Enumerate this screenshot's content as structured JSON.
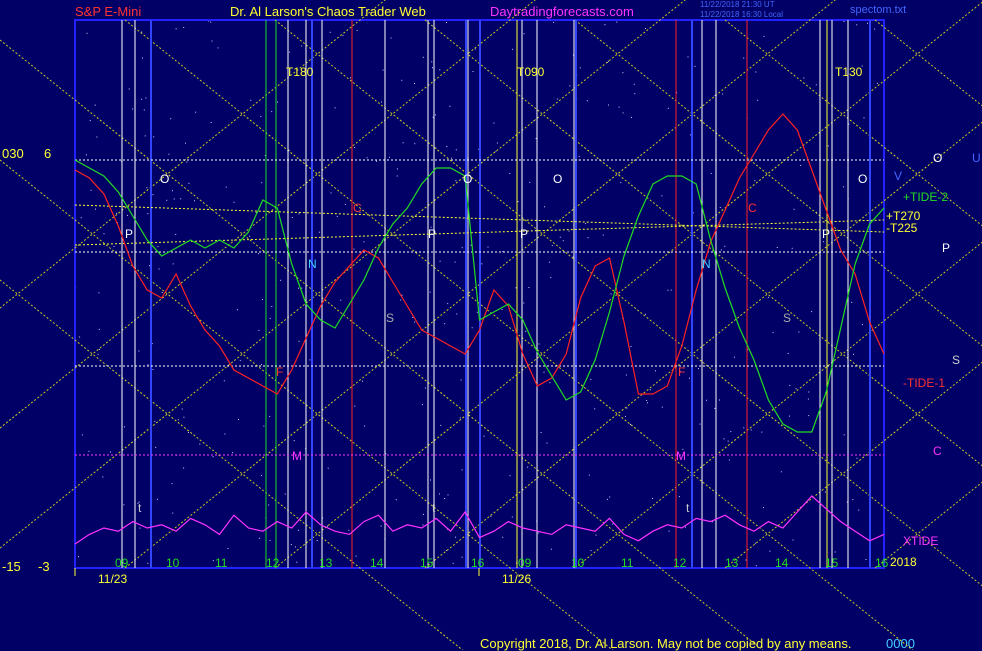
{
  "header": {
    "symbol": "S&P E-Mini",
    "author": "Dr. Al Larson's Chaos Trader Web",
    "site": "Daytradingforecasts.com",
    "stamp1": "11/22/2018 21:30 UT",
    "stamp2": "11/22/2018 16:30 Local",
    "file": "spectom.txt"
  },
  "footer": {
    "copyright": "Copyright 2018, Dr. Al Larson. May not be copied by any means.",
    "code": "0000"
  },
  "axis_left": {
    "top_a": "030",
    "top_b": "6",
    "bot_a": "-15",
    "bot_b": "-3"
  },
  "colors": {
    "bg": "#000066",
    "frame": "#2222ff",
    "price": "#ff2222",
    "green": "#22dd22",
    "xtide": "#ff33ff",
    "yellow": "#ffff33",
    "white": "#ffffff",
    "cyan": "#44ccff"
  },
  "chart_data": {
    "type": "line",
    "title": "S&P E-Mini",
    "dates": [
      "11/23",
      "11/26"
    ],
    "hour_ticks": [
      "09",
      "10",
      "11",
      "12",
      "13",
      "14",
      "15",
      "16",
      "09",
      "10",
      "11",
      "12",
      "13",
      "14",
      "15",
      "16"
    ],
    "year": "2018",
    "event_labels": [
      "T180",
      "T090",
      "T130"
    ],
    "right_labels": [
      "+TIDE-2",
      "+T270",
      "-T225",
      "-TIDE-1",
      "XTIDE"
    ],
    "planet_labels": [
      "O",
      "U",
      "V",
      "P",
      "S",
      "C"
    ],
    "inner_labels": [
      "O",
      "P",
      "C",
      "N",
      "S",
      "F",
      "M",
      "t"
    ],
    "series": [
      {
        "name": "S&P E-Mini",
        "values": [
          15,
          14,
          12,
          8,
          3,
          0,
          -1,
          2,
          -2,
          -5,
          -7,
          -10,
          -11,
          -12,
          -13,
          -10,
          -6,
          -2,
          1,
          3,
          5,
          4,
          1,
          -2,
          -5,
          -6,
          -7,
          -8,
          -5,
          0,
          -2,
          -8,
          -12,
          -11,
          -8,
          -1,
          3,
          4,
          -4,
          -13,
          -13,
          -12,
          -7,
          0,
          6,
          10,
          14,
          17,
          20,
          22,
          20,
          15,
          10,
          5,
          2,
          -4,
          -8
        ]
      },
      {
        "name": "+TIDE-2",
        "values": [
          15,
          14,
          13,
          11,
          8,
          5,
          3,
          4,
          5,
          4,
          5,
          4,
          6,
          10,
          9,
          2,
          -3,
          -5,
          -6,
          -3,
          0,
          4,
          7,
          9,
          12,
          14,
          14,
          13,
          -5,
          -4,
          -3,
          -5,
          -9,
          -12,
          -15,
          -14,
          -10,
          -4,
          3,
          8,
          12,
          13,
          13,
          12,
          5,
          -1,
          -6,
          -10,
          -15,
          -18,
          -19,
          -19,
          -14,
          -6,
          2,
          7,
          9
        ]
      },
      {
        "name": "XTIDE",
        "values": [
          5,
          8,
          10,
          9,
          12,
          10,
          11,
          9,
          13,
          11,
          8,
          14,
          10,
          9,
          12,
          10,
          15,
          11,
          9,
          8,
          12,
          14,
          9,
          11,
          10,
          13,
          9,
          15,
          7,
          9,
          12,
          10,
          9,
          8,
          11,
          10,
          9,
          13,
          8,
          6,
          9,
          11,
          10,
          13,
          12,
          14,
          11,
          9,
          12,
          10,
          15,
          20,
          16,
          12,
          9,
          6,
          8
        ]
      }
    ]
  }
}
